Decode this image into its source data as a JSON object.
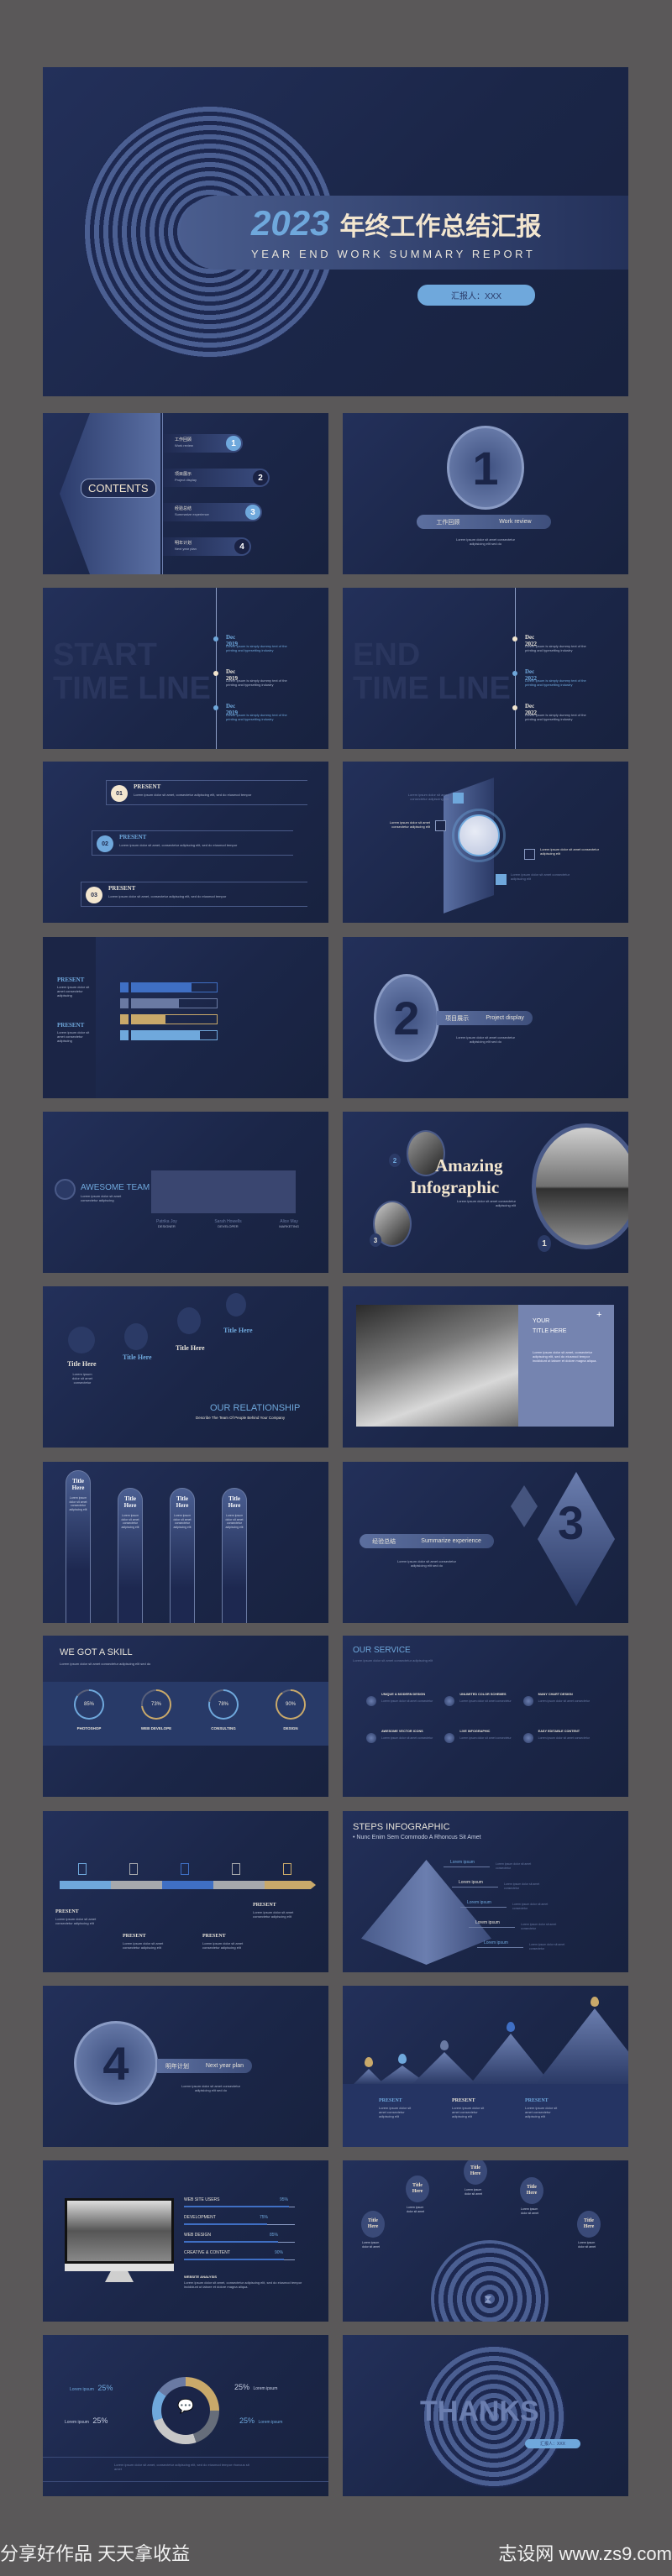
{
  "colors": {
    "background": "#5a5859",
    "slide": "#1c2747",
    "accent_blue": "#6fa8dc",
    "accent_gold": "#c9a96a",
    "cream": "#f3e6cf"
  },
  "cover": {
    "year": "2023",
    "title": "年终工作总结汇报",
    "subtitle": "YEAR END WORK SUMMARY REPORT",
    "reporter": "汇报人：XXX"
  },
  "contents": {
    "heading": "CONTENTS",
    "items": [
      {
        "cn": "工作回顾",
        "en": "Work review",
        "num": "1"
      },
      {
        "cn": "项目展示",
        "en": "Project display",
        "num": "2"
      },
      {
        "cn": "经验总结",
        "en": "Summarize experience",
        "num": "3"
      },
      {
        "cn": "明年计划",
        "en": "Next year plan",
        "num": "4"
      }
    ]
  },
  "section1": {
    "num": "1",
    "cn": "工作回顾",
    "en": "Work review",
    "body": "Lorem ipsum dolor sit amet consectetur adipisicing elit sed do"
  },
  "timeline_start": {
    "bg1": "START",
    "bg2": "TIME LINE",
    "events": [
      {
        "date": "Dec 2019",
        "text": "Lorem Ipsum is simply dummy text of the printing and typesetting industry"
      },
      {
        "date": "Dec 2019",
        "text": "Lorem Ipsum is simply dummy text of the printing and typesetting industry"
      },
      {
        "date": "Dec 2019",
        "text": "Lorem Ipsum is simply dummy text of the printing and typesetting industry"
      }
    ]
  },
  "timeline_end": {
    "bg1": "END",
    "bg2": "TIME LINE",
    "events": [
      {
        "date": "Dec 2022",
        "text": "Lorem Ipsum is simply dummy text of the printing and typesetting industry"
      },
      {
        "date": "Dec 2022",
        "text": "Lorem Ipsum is simply dummy text of the printing and typesetting industry"
      },
      {
        "date": "Dec 2022",
        "text": "Lorem Ipsum is simply dummy text of the printing and typesetting industry"
      }
    ]
  },
  "present_list": {
    "items": [
      {
        "num": "01",
        "title": "PRESENT",
        "text": "Lorem ipsum dolor sit amet, consectetur adipiscing elit, sed do eiusmod tempor"
      },
      {
        "num": "02",
        "title": "PRESENT",
        "text": "Lorem ipsum dolor sit amet, consectetur adipiscing elit, sed do eiusmod tempor"
      },
      {
        "num": "03",
        "title": "PRESENT",
        "text": "Lorem ipsum dolor sit amet, consectetur adipiscing elit, sed do eiusmod tempor"
      }
    ]
  },
  "globe": {
    "texts": [
      "Lorem ipsum dolor sit amet consectetur adipiscing elit",
      "Lorem ipsum dolor sit amet consectetur adipiscing elit",
      "Lorem ipsum dolor sit amet consectetur adipiscing elit",
      "Lorem ipsum dolor sit amet consectetur adipiscing elit"
    ],
    "icons": [
      "search-icon",
      "chat-icon",
      "money-bag-icon",
      "runner-icon"
    ]
  },
  "bars": {
    "present": [
      {
        "title": "PRESENT",
        "text": "Lorem ipsum dolor sit amet consectetur adipiscing"
      },
      {
        "title": "PRESENT",
        "text": "Lorem ipsum dolor sit amet consectetur adipiscing"
      }
    ],
    "items": [
      {
        "icon": "user-icon",
        "value": 0.7,
        "color": "#3f6fc4"
      },
      {
        "icon": "clock-icon",
        "value": 0.55,
        "color": "#6a7aa3"
      },
      {
        "icon": "gear-icon",
        "value": 0.4,
        "color": "#c9a96a"
      },
      {
        "icon": "edit-icon",
        "value": 0.8,
        "color": "#6fa8dc"
      }
    ]
  },
  "section2": {
    "num": "2",
    "cn": "项目展示",
    "en": "Project display",
    "body": "Lorem ipsum dolor sit amet consectetur adipisicing elit sed do"
  },
  "team": {
    "title": "AWESOME TEAM",
    "desc": "Lorem ipsum dolor sit amet consectetur adipiscing",
    "members": [
      {
        "name": "Patrika Joy",
        "role": "DESIGNER"
      },
      {
        "name": "Sarah Howells",
        "role": "DEVELOPER"
      },
      {
        "name": "Alice May",
        "role": "MARKETING"
      }
    ]
  },
  "infographic": {
    "title1": "Amazing",
    "title2": "Infographic",
    "body": "Lorem ipsum dolor sit amet consectetur adipiscing elit",
    "nums": [
      "1",
      "2",
      "3"
    ]
  },
  "relationship": {
    "titles": [
      "Title Here",
      "Title Here",
      "Title Here",
      "Title Here"
    ],
    "heading": "OUR RELATIONSHIP",
    "sub": "Describe The Team Of People Behind Your Company",
    "text": "Lorem ipsum dolor sit amet consectetur"
  },
  "photo_slide": {
    "title1": "YOUR",
    "title2": "TITLE HERE",
    "body": "Lorem ipsum dolor sit amet, consectetur adipiscing elit, sed do eiusmod tempor incididunt ut labore et dolore magna aliqua."
  },
  "pillars": {
    "items": [
      "Title Here",
      "Title Here",
      "Title Here",
      "Title Here"
    ],
    "text": "Lorem ipsum dolor sit amet consectetur adipiscing elit"
  },
  "section3": {
    "num": "3",
    "cn": "经验总结",
    "en": "Summarize experience",
    "body": "Lorem ipsum dolor sit amet consectetur adipisicing elit sed do"
  },
  "skills": {
    "title": "WE GOT A SKILL",
    "desc": "Lorem ipsum dolor sit amet consectetur adipiscing elit sed do",
    "items": [
      {
        "label": "PHOTOSHOP",
        "pct": "85%",
        "value": 85,
        "color": "#6fa8dc"
      },
      {
        "label": "WEB DEVELOPE",
        "pct": "73%",
        "value": 73,
        "color": "#c9a96a"
      },
      {
        "label": "CONSULTING",
        "pct": "78%",
        "value": 78,
        "color": "#6fa8dc"
      },
      {
        "label": "DESIGN",
        "pct": "90%",
        "value": 90,
        "color": "#c9a96a"
      }
    ]
  },
  "service": {
    "title": "OUR SERVICE",
    "desc": "Lorem ipsum dolor sit amet consectetur adipiscing elit",
    "items": [
      "UNIQUE & MODERN DESIGN",
      "UNLIMITED COLOR SCHEMES",
      "MANY CHART DESIGN",
      "AWESOME VECTOR ICONS",
      "LIVE INFOGRAPHIC",
      "EASY EDITABLE CONTENT"
    ],
    "text": "Lorem ipsum dolor sit amet consectetur"
  },
  "timeline_bar": {
    "segments": [
      "#6fa8dc",
      "#a7a9ad",
      "#3f6fc4",
      "#a7a9ad",
      "#c9a96a"
    ],
    "present": [
      "PRESENT",
      "PRESENT",
      "PRESENT",
      "PRESENT"
    ],
    "text": "Lorem ipsum dolor sit amet consectetur adipiscing elit"
  },
  "steps": {
    "title": "STEPS INFOGRAPHIC",
    "sub": "• Nunc Enim Sem Commodo A Rhoncus Sit Amet",
    "items": [
      "Lorem ipsum",
      "Lorem ipsum",
      "Lorem ipsum",
      "Lorem ipsum",
      "Lorem ipsum"
    ],
    "text": "Lorem ipsum dolor sit amet consectetur"
  },
  "section4": {
    "num": "4",
    "cn": "明年计划",
    "en": "Next year plan",
    "body": "Lorem ipsum dolor sit amet consectetur adipisicing elit sed do"
  },
  "mountains": {
    "present": [
      "PRESENT",
      "PRESENT",
      "PRESENT"
    ],
    "text": "Lorem ipsum dolor sit amet consectetur adipiscing elit"
  },
  "monitor": {
    "bars": [
      {
        "label": "WEB SITE USERS",
        "pct": "95%",
        "value": 95
      },
      {
        "label": "DEVELOPMENT",
        "pct": "75%",
        "value": 75
      },
      {
        "label": "WEB DESIGN",
        "pct": "85%",
        "value": 85
      },
      {
        "label": "CREATIVE & CONTENT",
        "pct": "90%",
        "value": 90
      }
    ],
    "analysis_title": "WEBSITE ANALYSIS",
    "analysis": "Lorem ipsum dolor sit amet, consectetur adipiscing elit, sed do eiusmod tempor incididunt ut labore et dolore magna aliqua."
  },
  "hourglass": {
    "titles": [
      "Title Here",
      "Title Here",
      "Title Here",
      "Title Here",
      "Title Here"
    ],
    "text": "Lorem ipsum dolor sit amet"
  },
  "donut": {
    "items": [
      {
        "label": "Lorem ipsum",
        "pct": "25%"
      },
      {
        "label": "Lorem ipsum",
        "pct": "25%"
      },
      {
        "label": "Lorem ipsum",
        "pct": "25%"
      },
      {
        "label": "Lorem ipsum",
        "pct": "25%"
      }
    ],
    "footer": "Lorem ipsum dolor sit amet, consectetur adipiscing elit, sed do eiusmod tempor rhoncus sit amet"
  },
  "thanks": {
    "title": "THANKS",
    "reporter": "汇报人：XXX"
  },
  "footer": {
    "left": "分享好作品 天天拿收益",
    "right": "志设网 www.zs9.com"
  }
}
